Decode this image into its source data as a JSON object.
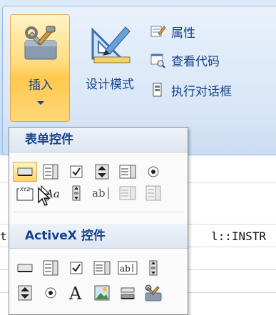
{
  "ribbon": {
    "insert_label": "插入",
    "design_mode_label": "设计模式",
    "properties_label": "属性",
    "view_code_label": "查看代码",
    "run_dialog_label": "执行对话框"
  },
  "dropdown": {
    "form_controls_header": "表单控件",
    "activex_header": "ActiveX 控件"
  },
  "sheet": {
    "code_fragment_left": "t",
    "code_fragment_right": "l::INSTR"
  },
  "colors": {
    "accent": "#15428b",
    "hover_fill": "#ffd56a",
    "ribbon_bg": "#d8e6f7"
  }
}
